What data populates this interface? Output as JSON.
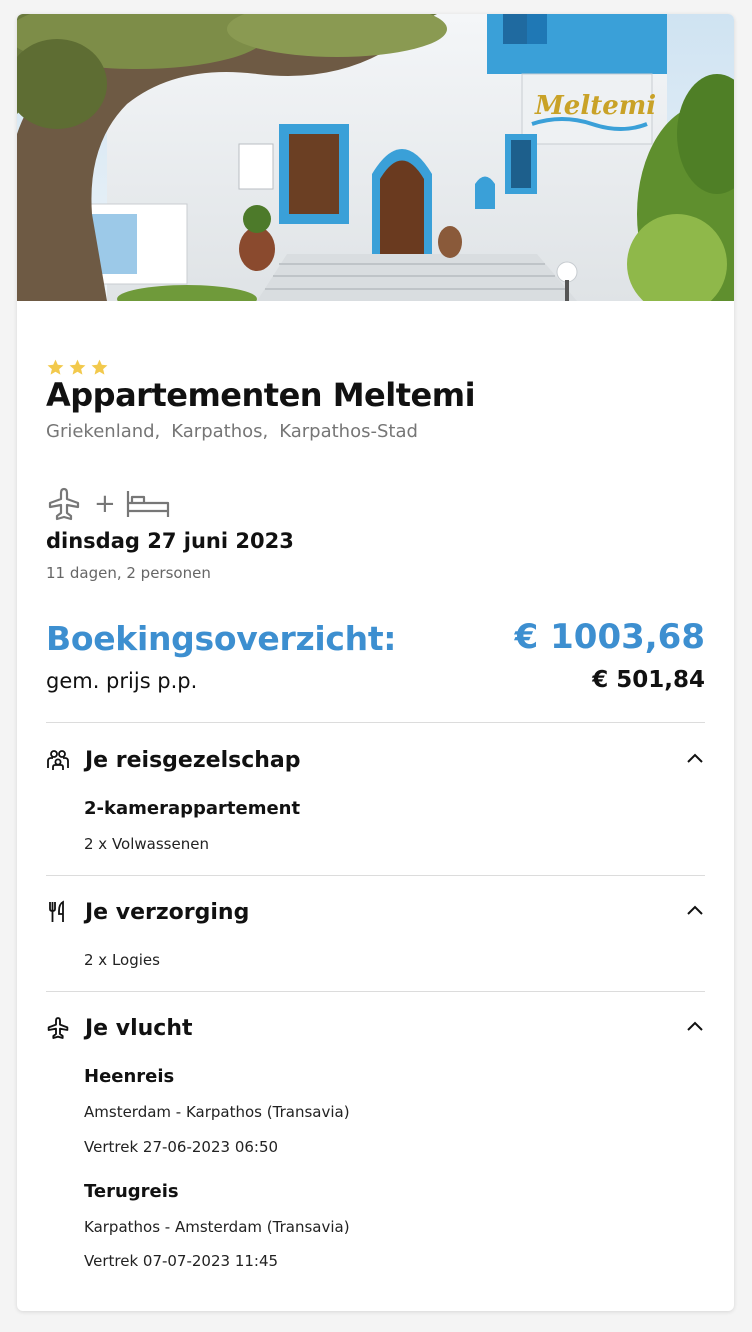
{
  "hotel": {
    "stars": 3,
    "name": "Appartementen Meltemi",
    "location": [
      "Griekenland,",
      "Karpathos,",
      "Karpathos-Stad"
    ],
    "sign_text": "Meltemi"
  },
  "trip": {
    "date": "dinsdag 27 juni 2023",
    "duration": "11 dagen, 2 personen",
    "plus": "+"
  },
  "price": {
    "title": "Boekingsoverzicht:",
    "total": "€ 1003,68",
    "per_person_label": "gem. prijs p.p.",
    "per_person": "€ 501,84"
  },
  "sections": {
    "party": {
      "title": "Je reisgezelschap",
      "room": "2-kamerappartement",
      "guests": "2 x Volwassenen"
    },
    "board": {
      "title": "Je verzorging",
      "meal": "2 x Logies"
    },
    "flight": {
      "title": "Je vlucht",
      "outbound_title": "Heenreis",
      "outbound_route": "Amsterdam - Karpathos (Transavia)",
      "outbound_departure": "Vertrek 27-06-2023 06:50",
      "return_title": "Terugreis",
      "return_route": "Karpathos - Amsterdam (Transavia)",
      "return_departure": "Vertrek 07-07-2023 11:45"
    }
  },
  "colors": {
    "accent": "#3d8fd0",
    "star": "#f2c94c",
    "text": "#111111",
    "muted": "#767676"
  }
}
